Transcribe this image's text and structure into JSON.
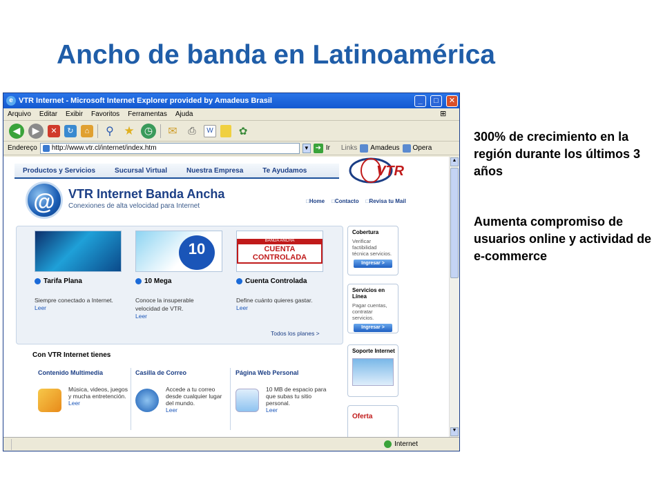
{
  "slide": {
    "title": "Ancho de banda en Latinoamérica",
    "bullets": [
      "300% de crecimiento en la región durante los últimos 3 años",
      "Aumenta compromiso de usuarios online y actividad de e-commerce"
    ]
  },
  "browser": {
    "title": "VTR Internet - Microsoft Internet Explorer provided by Amadeus Brasil",
    "menu": [
      "Arquivo",
      "Editar",
      "Exibir",
      "Favoritos",
      "Ferramentas",
      "Ajuda"
    ],
    "address_label": "Endereço",
    "url": "http://www.vtr.cl/internet/index.htm",
    "go_label": "Ir",
    "links_label": "Links",
    "links": [
      "Amadeus",
      "Opera"
    ],
    "status_zone": "Internet"
  },
  "page": {
    "nav": [
      "Productos y Servicios",
      "Sucursal Virtual",
      "Nuestra Empresa",
      "Te Ayudamos"
    ],
    "logo_text": "VTR",
    "brand_title": "VTR Internet Banda Ancha",
    "brand_subtitle": "Conexiones de alta velocidad para Internet",
    "top_links": [
      "Home",
      "Contacto",
      "Revisa tu Mail"
    ],
    "promos": [
      {
        "title": "Tarifa Plana",
        "desc": "Siempre conectado a Internet.",
        "link": "Leer"
      },
      {
        "title": "10 Mega",
        "desc": "Conoce la insuperable velocidad de VTR.",
        "link": "Leer",
        "badge": "10"
      },
      {
        "title": "Cuenta Controlada",
        "desc": "Define cuánto quieres gastar.",
        "link": "Leer",
        "banner_top": "BANDA ANCHA",
        "banner": "CUENTA CONTROLADA"
      }
    ],
    "all_plans": "Todos los planes >",
    "features_heading": "Con VTR Internet tienes",
    "features": [
      {
        "title": "Contenido Multimedia",
        "desc": "Música, videos, juegos y mucha entretención.",
        "link": "Leer"
      },
      {
        "title": "Casilla de Correo",
        "desc": "Accede a tu correo desde cualquier lugar del mundo.",
        "link": "Leer"
      },
      {
        "title": "Página Web Personal",
        "desc": "10 MB de espacio para que subas tu sitio personal.",
        "link": "Leer"
      }
    ],
    "sidebar": [
      {
        "title": "Cobertura",
        "desc": "Verificar factibilidad técnica servicios.",
        "button": "Ingresar >"
      },
      {
        "title": "Servicios en Línea",
        "desc": "Pagar cuentas, contratar servicios.",
        "button": "Ingresar >"
      },
      {
        "title": "Soporte Internet"
      },
      {
        "title": "Oferta"
      }
    ]
  },
  "colors": {
    "title_blue": "#1f5da8",
    "vtr_red": "#c01a1a",
    "link_blue": "#1b3e85"
  }
}
